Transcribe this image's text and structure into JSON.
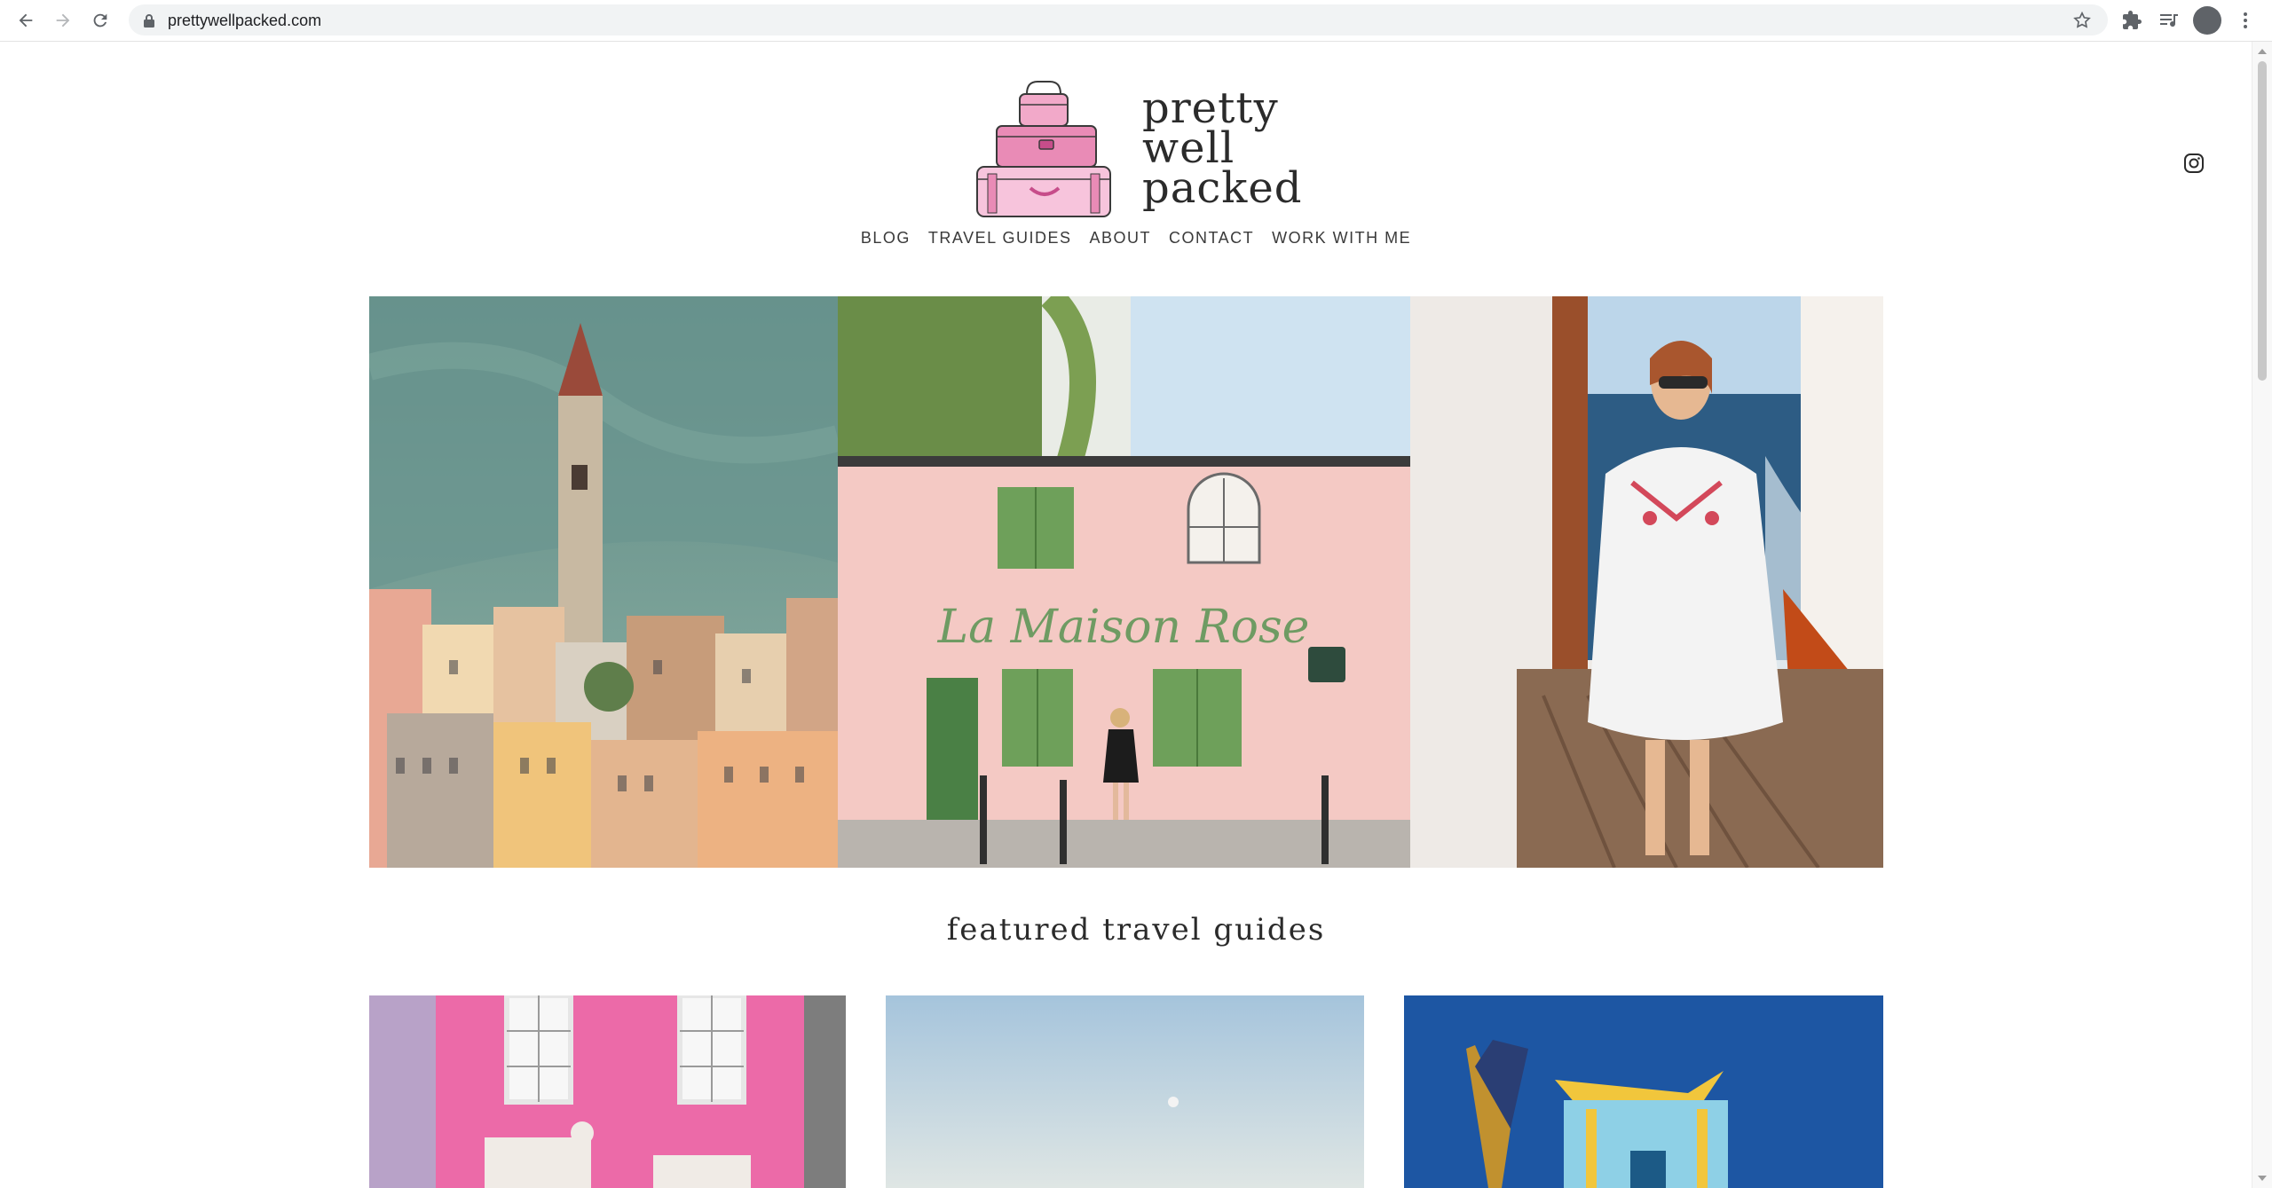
{
  "browser": {
    "url": "prettywellpacked.com",
    "icons": {
      "back": "back-arrow-icon",
      "forward": "forward-arrow-icon",
      "reload": "reload-icon",
      "lock": "lock-icon",
      "bookmark": "star-icon",
      "extensions": "puzzle-icon",
      "media": "media-control-icon",
      "profile": "avatar",
      "menu": "kebab-menu-icon"
    }
  },
  "site": {
    "logo_lines": [
      "pretty",
      "well",
      "packed"
    ],
    "nav": [
      "BLOG",
      "TRAVEL GUIDES",
      "ABOUT",
      "CONTACT",
      "WORK WITH ME"
    ],
    "social_icon": "instagram-icon",
    "hero_images": [
      {
        "alt": "Lakeside Italian village with bell tower"
      },
      {
        "alt": "Pink cafe La Maison Rose with green shutters",
        "sign_text": "La Maison Rose"
      },
      {
        "alt": "Woman in white dress on boat deck"
      }
    ],
    "section_title": "featured travel guides",
    "guide_images": [
      {
        "alt": "Pink townhouse facade"
      },
      {
        "alt": "Pale blue sky with moon"
      },
      {
        "alt": "Colorful lifeguard hut"
      }
    ]
  },
  "colors": {
    "accent_pink": "#f2a9c9",
    "text_dark": "#2b2b2b",
    "chrome_gray": "#5f6368"
  }
}
